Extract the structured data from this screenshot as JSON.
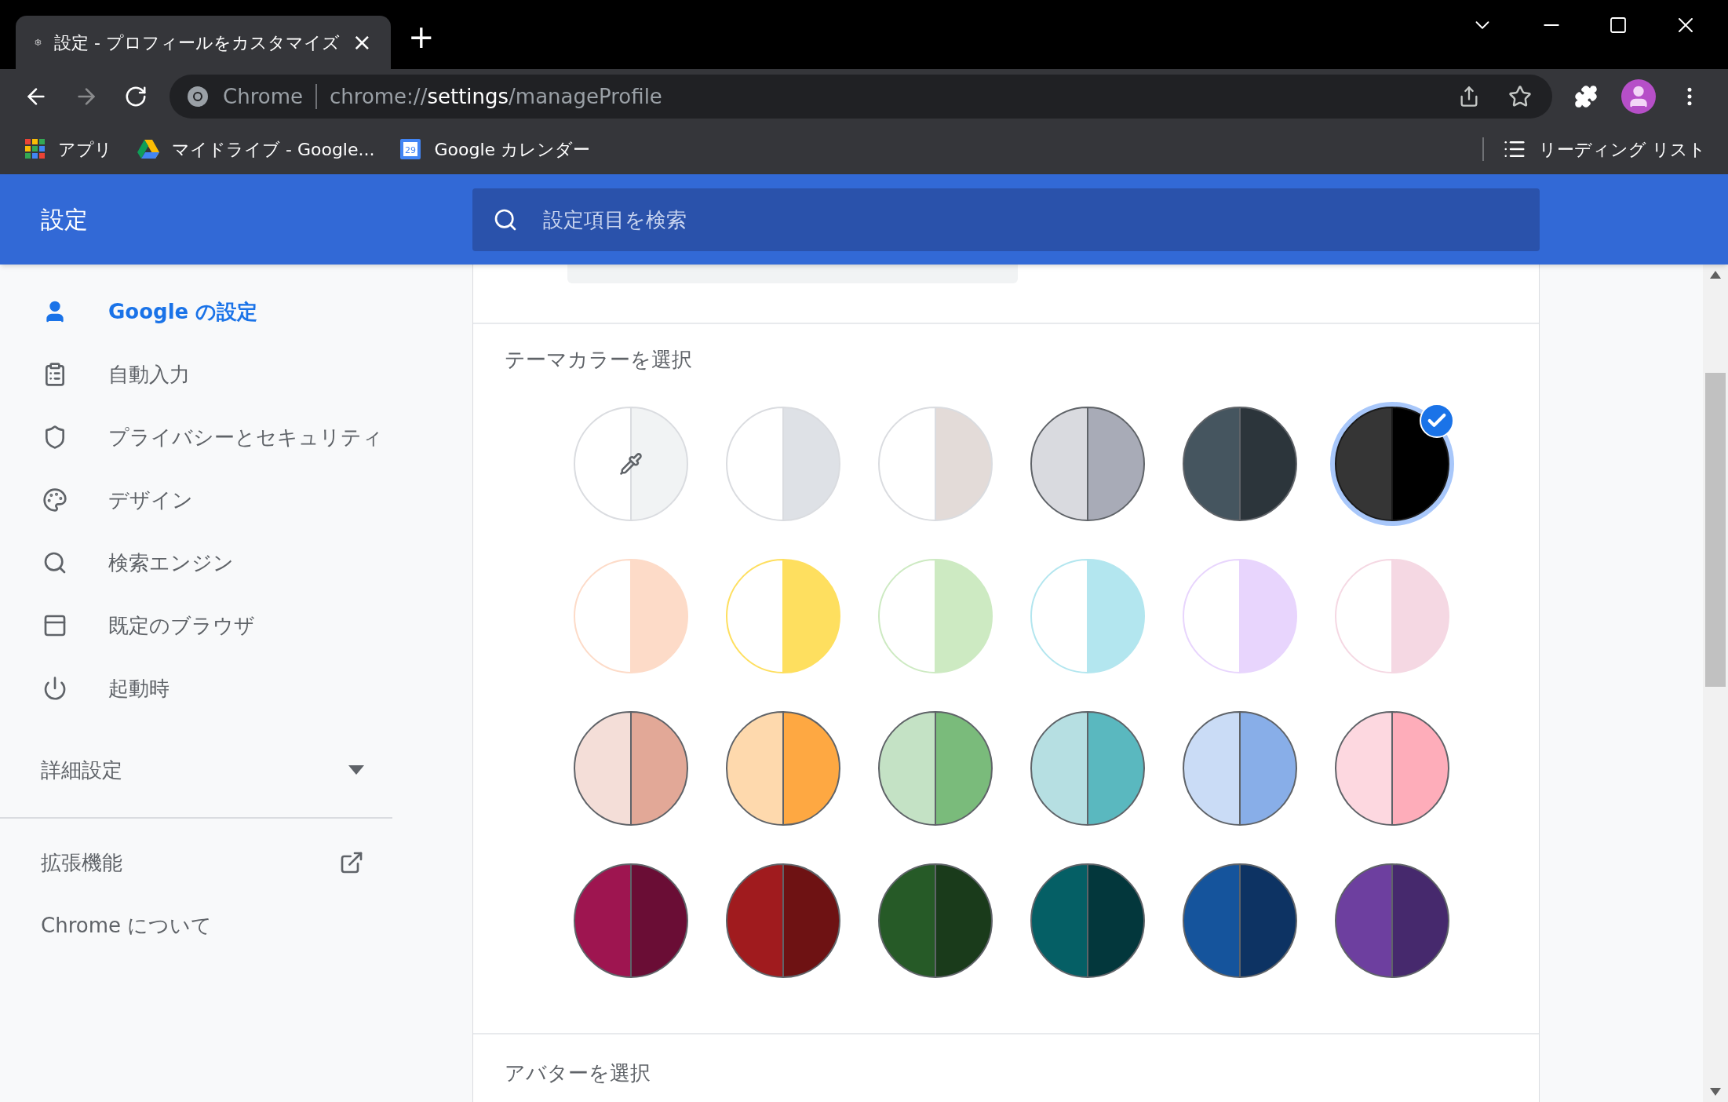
{
  "tab": {
    "title": "設定 - プロフィールをカスタマイズ",
    "close": "×",
    "new_tab": "+"
  },
  "omnibox": {
    "site": "Chrome",
    "url_scheme": "chrome://",
    "url_host": "settings",
    "url_path": "/manageProfile"
  },
  "bookmarks": [
    {
      "label": "アプリ",
      "kind": "apps"
    },
    {
      "label": "マイドライブ - Google...",
      "kind": "drive"
    },
    {
      "label": "Google カレンダー",
      "kind": "calendar",
      "icon_text": "29"
    }
  ],
  "reading_list": "リーディング リスト",
  "header": {
    "title": "設定",
    "search_placeholder": "設定項目を検索"
  },
  "sidebar": {
    "items": [
      {
        "label": "Google の設定",
        "selected": true
      },
      {
        "label": "自動入力",
        "selected": false
      },
      {
        "label": "プライバシーとセキュリティ",
        "selected": false
      },
      {
        "label": "デザイン",
        "selected": false
      },
      {
        "label": "検索エンジン",
        "selected": false
      },
      {
        "label": "既定のブラウザ",
        "selected": false
      },
      {
        "label": "起動時",
        "selected": false
      }
    ],
    "advanced": {
      "label": "詳細設定",
      "expanded": false
    },
    "extensions": "拡張機能",
    "about": "Chrome について"
  },
  "theme_section": {
    "title": "テーマカラーを選択",
    "swatches": [
      {
        "kind": "custom",
        "halves": [
          {
            "color": "#ffffff"
          },
          {
            "color": "#f1f3f4"
          }
        ],
        "selected": false
      },
      {
        "kind": "color",
        "halves": [
          {
            "color": "#ffffff"
          },
          {
            "color": "#dee1e6"
          }
        ],
        "selected": false
      },
      {
        "kind": "color",
        "halves": [
          {
            "color": "#ffffff"
          },
          {
            "color": "#e3dbd8"
          }
        ],
        "selected": false
      },
      {
        "kind": "color",
        "halves": [
          {
            "color": "#d9dadf"
          },
          {
            "color": "#a8abb7"
          }
        ],
        "selected": false
      },
      {
        "kind": "color",
        "halves": [
          {
            "color": "#45555f"
          },
          {
            "color": "#2c353b"
          }
        ],
        "selected": false
      },
      {
        "kind": "color",
        "halves": [
          {
            "color": "#353535"
          },
          {
            "color": "#000000"
          }
        ],
        "selected": true
      },
      {
        "kind": "color",
        "halves": [
          {
            "color": "#ffffff"
          },
          {
            "color": "#fddbc8"
          }
        ],
        "selected": false
      },
      {
        "kind": "color",
        "halves": [
          {
            "color": "#ffffff"
          },
          {
            "color": "#fedf5f"
          }
        ],
        "selected": false
      },
      {
        "kind": "color",
        "halves": [
          {
            "color": "#ffffff"
          },
          {
            "color": "#cdeac2"
          }
        ],
        "selected": false
      },
      {
        "kind": "color",
        "halves": [
          {
            "color": "#ffffff"
          },
          {
            "color": "#b3e6ef"
          }
        ],
        "selected": false
      },
      {
        "kind": "color",
        "halves": [
          {
            "color": "#ffffff"
          },
          {
            "color": "#e8d5fd"
          }
        ],
        "selected": false
      },
      {
        "kind": "color",
        "halves": [
          {
            "color": "#ffffff"
          },
          {
            "color": "#f5d8e3"
          }
        ],
        "selected": false
      },
      {
        "kind": "color",
        "halves": [
          {
            "color": "#f4ded8"
          },
          {
            "color": "#e2a897"
          }
        ],
        "selected": false
      },
      {
        "kind": "color",
        "halves": [
          {
            "color": "#fed9ad"
          },
          {
            "color": "#fea842"
          }
        ],
        "selected": false
      },
      {
        "kind": "color",
        "halves": [
          {
            "color": "#c4e2c5"
          },
          {
            "color": "#7abb7b"
          }
        ],
        "selected": false
      },
      {
        "kind": "color",
        "halves": [
          {
            "color": "#b6dfe2"
          },
          {
            "color": "#5ab8bf"
          }
        ],
        "selected": false
      },
      {
        "kind": "color",
        "halves": [
          {
            "color": "#cadcf6"
          },
          {
            "color": "#88aee8"
          }
        ],
        "selected": false
      },
      {
        "kind": "color",
        "halves": [
          {
            "color": "#fdd8e0"
          },
          {
            "color": "#feadba"
          }
        ],
        "selected": false
      },
      {
        "kind": "color",
        "halves": [
          {
            "color": "#9e1550"
          },
          {
            "color": "#6a0d35"
          }
        ],
        "selected": false
      },
      {
        "kind": "color",
        "halves": [
          {
            "color": "#a01b1e"
          },
          {
            "color": "#6e1213"
          }
        ],
        "selected": false
      },
      {
        "kind": "color",
        "halves": [
          {
            "color": "#265a27"
          },
          {
            "color": "#1a3b1b"
          }
        ],
        "selected": false
      },
      {
        "kind": "color",
        "halves": [
          {
            "color": "#055f65"
          },
          {
            "color": "#03373c"
          }
        ],
        "selected": false
      },
      {
        "kind": "color",
        "halves": [
          {
            "color": "#15549c"
          },
          {
            "color": "#0d3363"
          }
        ],
        "selected": false
      },
      {
        "kind": "color",
        "halves": [
          {
            "color": "#6d3f9f"
          },
          {
            "color": "#46296d"
          }
        ],
        "selected": false
      }
    ]
  },
  "avatar_section": {
    "title": "アバターを選択"
  }
}
